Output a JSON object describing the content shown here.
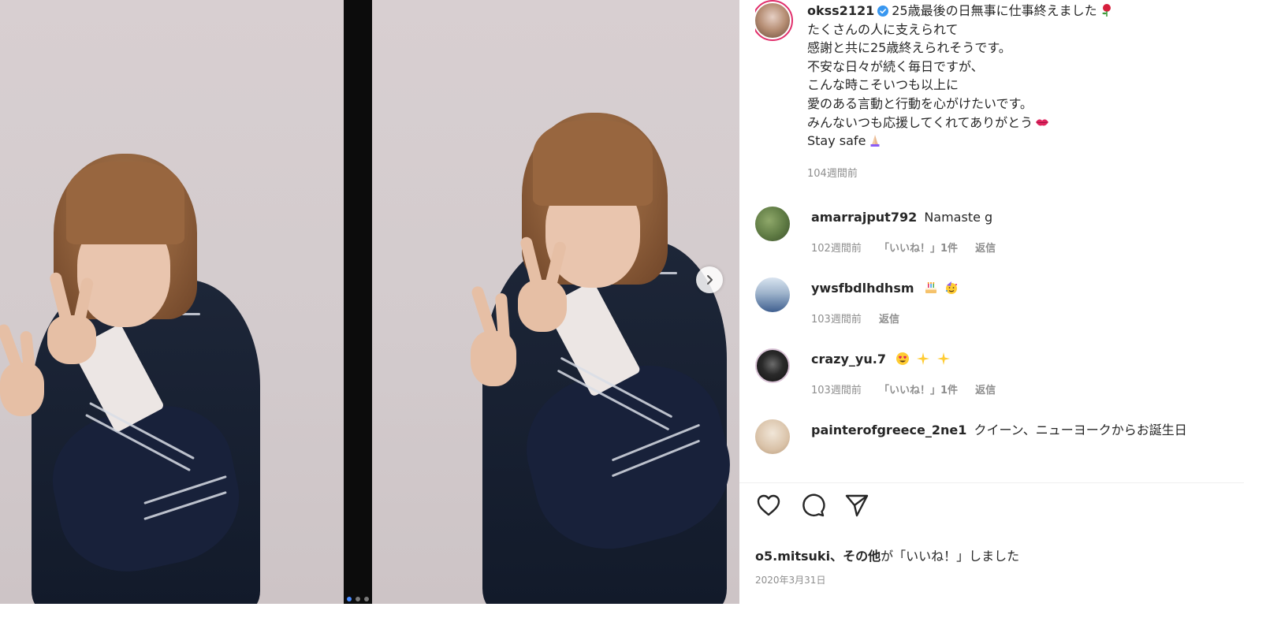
{
  "post": {
    "author": "okss2121",
    "caption_lines": [
      "25歳最後の日無事に仕事終えました",
      "たくさんの人に支えられて",
      "感謝と共に25歳終えられそうです。",
      "不安な日々が続く毎日ですが、",
      "こんな時こそいつも以上に",
      "愛のある言動と行動を心がけたいです。",
      "みんないつも応援してくれてありがとう",
      "Stay safe"
    ],
    "caption_time": "104週間前"
  },
  "comments": [
    {
      "username": "amarrajput792",
      "text": "Namaste g",
      "time": "102週間前",
      "likes": "「いいね！」1件",
      "reply": "返信"
    },
    {
      "username": "ywsfbdlhdhsm",
      "text": "",
      "time": "103週間前",
      "reply": "返信"
    },
    {
      "username": "crazy_yu.7",
      "text": "",
      "time": "103週間前",
      "likes": "「いいね！」1件",
      "reply": "返信"
    },
    {
      "username": "painterofgreece_2ne1",
      "text": "クイーン、ニューヨークからお誕生日"
    }
  ],
  "likes_summary": {
    "user": "o5.mitsuki、",
    "others": "その他",
    "suffix": "が「いいね！」しました"
  },
  "date": "2020年3月31日",
  "icons": {
    "verified": "verified-badge-icon",
    "like": "heart-icon",
    "comment": "comment-bubble-icon",
    "share": "paper-plane-icon",
    "next": "chevron-right-icon"
  },
  "colors": {
    "verified": "#3897f0",
    "story_ring": "#e1306c",
    "muted": "#8e8e8e",
    "text": "#262626"
  }
}
